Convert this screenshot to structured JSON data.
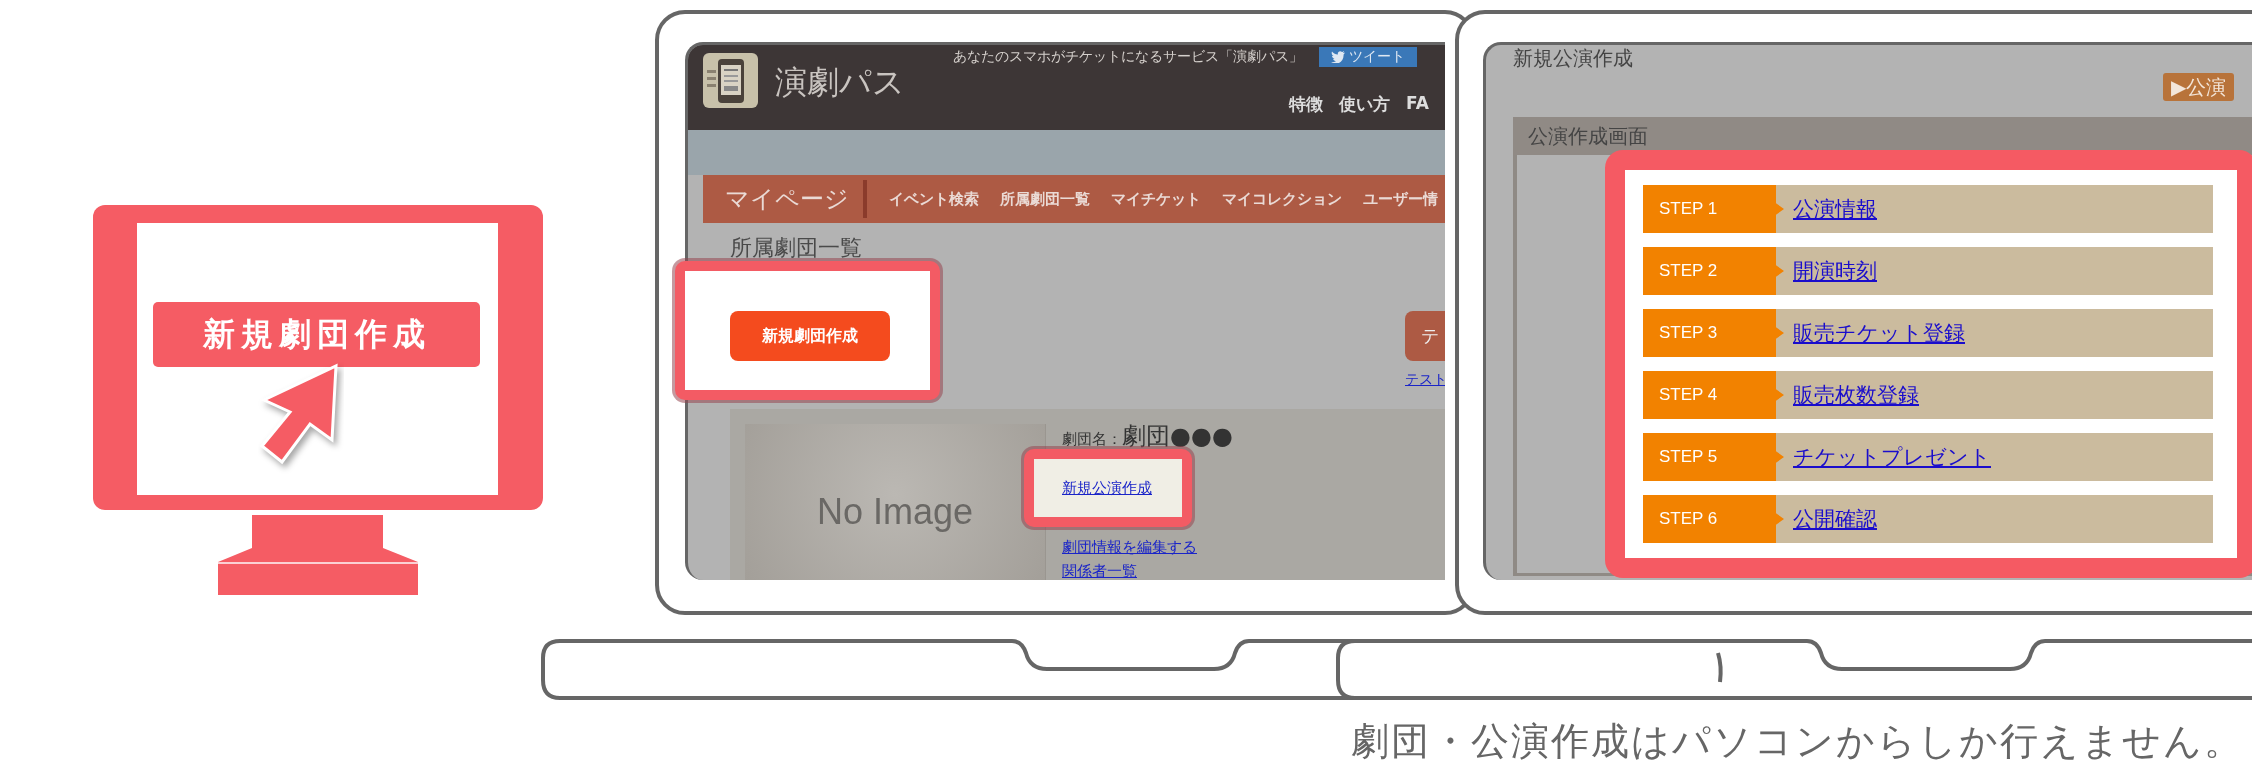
{
  "monitor_icon": {
    "label": "新規劇団作成"
  },
  "site_screen": {
    "logo_title": "演劇パス",
    "tagline": "あなたのスマホがチケットになるサービス「演劇パス」",
    "tweet_button": "ツイート",
    "header_nav": [
      "特徴",
      "使い方",
      "FA"
    ],
    "menu_title": "マイページ",
    "menu_items": [
      "イベント検索",
      "所属劇団一覧",
      "マイチケット",
      "マイコレクション",
      "ユーザー情"
    ],
    "heading": "所属劇団一覧",
    "create_button": {
      "label": "新規劇団作成",
      "highlighted": true
    },
    "side_button": "テ",
    "side_link": "テスト",
    "troupe": {
      "image_label": "No Image",
      "name_label": "劇団名：",
      "name": "劇団●●●",
      "links": [
        {
          "label": "新規公演作成",
          "highlighted": true
        },
        {
          "label": "劇団情報を編集する",
          "highlighted": false
        },
        {
          "label": "関係者一覧",
          "highlighted": false
        }
      ]
    }
  },
  "create_screen": {
    "title": "新規公演作成",
    "action_button": "▶公演",
    "panel_title": "公演作成画面",
    "steps_highlighted": true,
    "steps": [
      {
        "step": "STEP 1",
        "link": "公演情報"
      },
      {
        "step": "STEP 2",
        "link": "開演時刻"
      },
      {
        "step": "STEP 3",
        "link": "販売チケット登録"
      },
      {
        "step": "STEP 4",
        "link": "販売枚数登録"
      },
      {
        "step": "STEP 5",
        "link": "チケットプレゼント"
      },
      {
        "step": "STEP 6",
        "link": "公開確認"
      }
    ]
  },
  "caption": "劇団・公演作成はパソコンからしか行えません。"
}
